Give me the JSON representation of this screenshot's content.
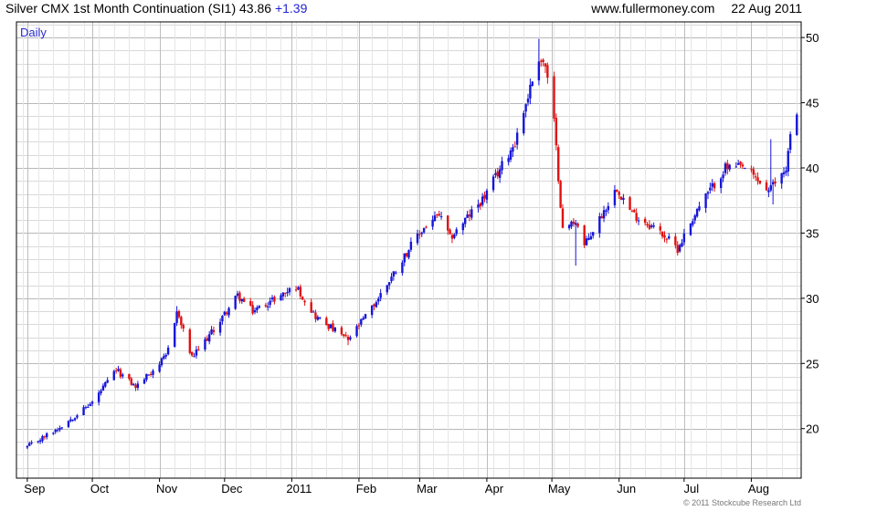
{
  "header": {
    "title": "Silver CMX 1st Month Continuation (SI1)",
    "last": "43.86",
    "change": "+1.39",
    "site": "www.fullermoney.com",
    "date": "22 Aug 2011"
  },
  "period_label": "Daily",
  "copyright": "© 2011 Stockcube Research Ltd",
  "colors": {
    "up": "#1616d8",
    "down": "#e01010",
    "grid": "#d9d9d9",
    "frame": "#000000",
    "change_text": "#1f1fd1"
  },
  "chart_data": {
    "type": "candlestick",
    "title": "Silver CMX 1st Month Continuation (SI1)",
    "frequency": "Daily",
    "ylim": [
      16.2,
      51.2
    ],
    "y_ticks": [
      20,
      25,
      30,
      35,
      40,
      45,
      50
    ],
    "x_ticks": [
      "Sep",
      "Oct",
      "Nov",
      "Dec",
      "2011",
      "Feb",
      "Mar",
      "Apr",
      "May",
      "Jun",
      "Jul",
      "Aug"
    ],
    "y_axis_side": "right",
    "grid": true,
    "up_color": "blue",
    "down_color": "red",
    "anchors": [
      [
        "2010-09-01",
        18.6
      ],
      [
        "2010-09-15",
        20.0
      ],
      [
        "2010-10-01",
        22.0
      ],
      [
        "2010-10-12",
        24.5
      ],
      [
        "2010-10-21",
        23.2
      ],
      [
        "2010-11-04",
        25.5
      ],
      [
        "2010-11-09",
        29.0
      ],
      [
        "2010-11-16",
        25.4
      ],
      [
        "2010-11-26",
        27.6
      ],
      [
        "2010-12-07",
        30.2
      ],
      [
        "2010-12-14",
        29.0
      ],
      [
        "2011-01-03",
        30.9
      ],
      [
        "2011-01-12",
        28.6
      ],
      [
        "2011-01-27",
        26.8
      ],
      [
        "2011-02-08",
        29.5
      ],
      [
        "2011-02-24",
        33.8
      ],
      [
        "2011-03-03",
        35.4
      ],
      [
        "2011-03-10",
        36.4
      ],
      [
        "2011-03-15",
        34.6
      ],
      [
        "2011-03-31",
        37.8
      ],
      [
        "2011-04-14",
        42.0
      ],
      [
        "2011-04-25",
        48.5
      ],
      [
        "2011-04-28",
        47.8
      ],
      [
        "2011-05-02",
        43.5
      ],
      [
        "2011-05-06",
        35.2
      ],
      [
        "2011-05-12",
        36.0
      ],
      [
        "2011-05-16",
        34.0
      ],
      [
        "2011-05-31",
        38.5
      ],
      [
        "2011-06-07",
        36.5
      ],
      [
        "2011-06-20",
        35.1
      ],
      [
        "2011-06-28",
        33.8
      ],
      [
        "2011-07-07",
        36.8
      ],
      [
        "2011-07-20",
        40.0
      ],
      [
        "2011-07-29",
        40.0
      ],
      [
        "2011-08-09",
        38.2
      ],
      [
        "2011-08-17",
        40.0
      ],
      [
        "2011-08-19",
        42.5
      ],
      [
        "2011-08-22",
        43.86
      ]
    ],
    "notable_highs": [
      [
        "2011-04-25",
        49.9
      ],
      [
        "2010-11-09",
        29.4
      ],
      [
        "2011-08-22",
        44.0
      ],
      [
        "2011-08-10",
        42.2
      ]
    ],
    "notable_lows": [
      [
        "2011-05-12",
        32.5
      ],
      [
        "2011-01-27",
        26.4
      ],
      [
        "2011-06-28",
        33.5
      ],
      [
        "2011-08-11",
        37.2
      ]
    ]
  }
}
